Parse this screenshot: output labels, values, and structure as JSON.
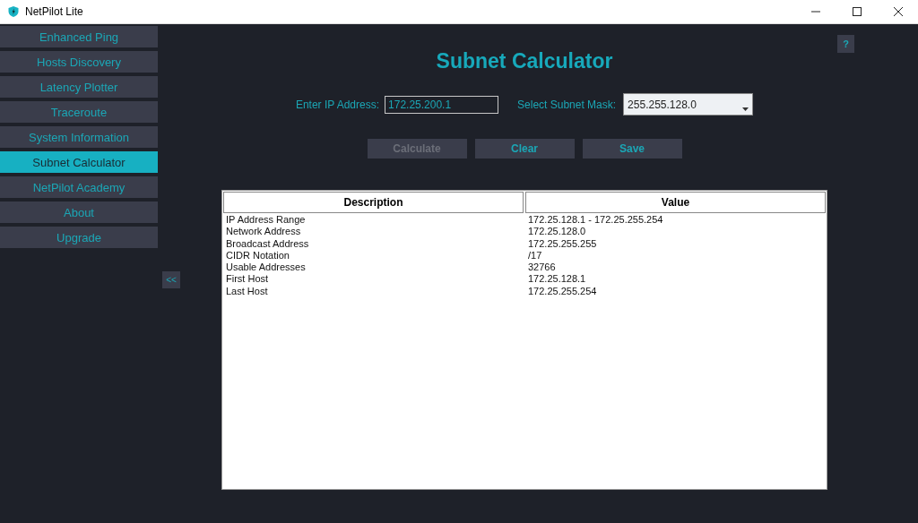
{
  "window": {
    "title": "NetPilot Lite"
  },
  "sidebar": {
    "items": [
      {
        "label": "Enhanced Ping",
        "selected": false
      },
      {
        "label": "Hosts Discovery",
        "selected": false
      },
      {
        "label": "Latency Plotter",
        "selected": false
      },
      {
        "label": "Traceroute",
        "selected": false
      },
      {
        "label": "System Information",
        "selected": false
      },
      {
        "label": "Subnet Calculator",
        "selected": true
      },
      {
        "label": "NetPilot Academy",
        "selected": false
      },
      {
        "label": "About",
        "selected": false
      },
      {
        "label": "Upgrade",
        "selected": false
      }
    ],
    "collapse_button": "<<"
  },
  "help_button": "?",
  "title": "Subnet Calculator",
  "form": {
    "ip_label": "Enter IP Address:",
    "ip_value": "172.25.200.1",
    "mask_label": "Select Subnet Mask:",
    "mask_value": "255.255.128.0"
  },
  "buttons": [
    {
      "label": "Calculate",
      "disabled": true
    },
    {
      "label": "Clear",
      "disabled": false
    },
    {
      "label": "Save",
      "disabled": false
    }
  ],
  "table": {
    "columns": [
      "Description",
      "Value"
    ],
    "rows": [
      [
        "IP Address Range",
        "172.25.128.1 - 172.25.255.254"
      ],
      [
        "Network Address",
        "172.25.128.0"
      ],
      [
        "Broadcast Address",
        "172.25.255.255"
      ],
      [
        "CIDR Notation",
        "/17"
      ],
      [
        "Usable Addresses",
        "32766"
      ],
      [
        "First Host",
        "172.25.128.1"
      ],
      [
        "Last Host",
        "172.25.255.254"
      ]
    ]
  }
}
